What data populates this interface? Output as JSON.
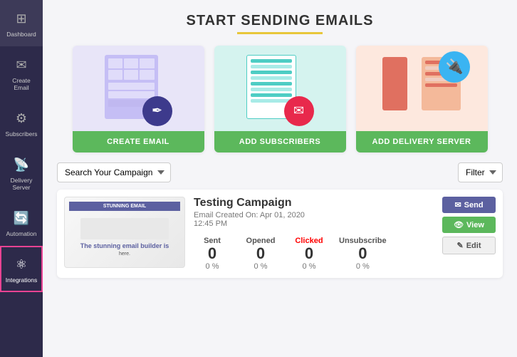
{
  "sidebar": {
    "items": [
      {
        "id": "dashboard",
        "label": "Dashboard",
        "icon": "⊞",
        "active": false
      },
      {
        "id": "create-email",
        "label": "Create Email",
        "icon": "✉",
        "active": false
      },
      {
        "id": "subscribers",
        "label": "Subscribers",
        "icon": "⚙",
        "active": false
      },
      {
        "id": "delivery-server",
        "label": "Delivery Server",
        "icon": "📡",
        "active": false
      },
      {
        "id": "automation",
        "label": "Automation",
        "icon": "🔄",
        "active": false
      },
      {
        "id": "integrations",
        "label": "Integrations",
        "icon": "⚛",
        "active": true
      }
    ]
  },
  "header": {
    "title": "START SENDING EMAILS"
  },
  "cards": [
    {
      "id": "create-email",
      "button_label": "CREATE EMAIL"
    },
    {
      "id": "add-subscribers",
      "button_label": "ADD SUBSCRIBERS"
    },
    {
      "id": "add-delivery-server",
      "button_label": "ADD DELIVERY SERVER"
    }
  ],
  "filter": {
    "search_placeholder": "Search Your Campaign",
    "filter_label": "Filter"
  },
  "campaign": {
    "name": "Testing Campaign",
    "meta": "Email Created On: Apr 01, 2020\n12:45 PM",
    "thumb_header": "STUNNING EMAIL",
    "thumb_body_line1": "The stunning email builder is",
    "thumb_body_line2": "here.",
    "stats": [
      {
        "label": "Sent",
        "value": "0",
        "percent": "0 %"
      },
      {
        "label": "Opened",
        "value": "0",
        "percent": "0 %"
      },
      {
        "label": "Clicked",
        "value": "0",
        "percent": "0 %",
        "highlight": true
      },
      {
        "label": "Unsubscribe",
        "value": "0",
        "percent": "0 %"
      }
    ],
    "actions": [
      {
        "id": "send",
        "label": "Send",
        "icon": "✉",
        "style": "send"
      },
      {
        "id": "view",
        "label": "View",
        "icon": "👁",
        "style": "view"
      },
      {
        "id": "edit",
        "label": "Edit",
        "icon": "✎",
        "style": "edit"
      }
    ]
  }
}
